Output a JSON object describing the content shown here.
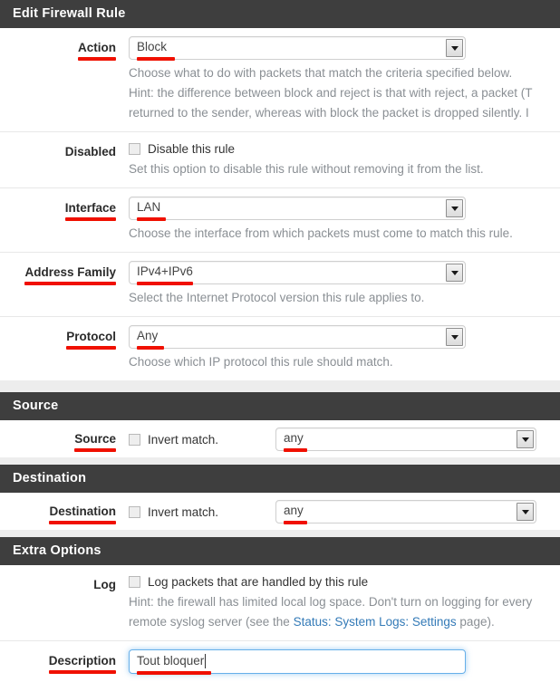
{
  "window": {
    "title": "Edit Firewall Rule"
  },
  "sections": {
    "source_title": "Source",
    "destination_title": "Destination",
    "extra_options_title": "Extra Options"
  },
  "colors": {
    "header_bg": "#3e3e3e",
    "header_text": "#ffffff",
    "annotation_red": "#f01000",
    "link_blue": "#337ab7",
    "focus_blue": "#66afe9",
    "hint_gray": "#8a8f94"
  },
  "fields": {
    "action": {
      "label": "Action",
      "value": "Block",
      "hint_line1": "Choose what to do with packets that match the criteria specified below.",
      "hint_line2": "Hint: the difference between block and reject is that with reject, a packet (T",
      "hint_line3": "returned to the sender, whereas with block the packet is dropped silently. I"
    },
    "disabled": {
      "label": "Disabled",
      "checkbox_label": "Disable this rule",
      "checked": false,
      "hint": "Set this option to disable this rule without removing it from the list."
    },
    "interface": {
      "label": "Interface",
      "value": "LAN",
      "hint": "Choose the interface from which packets must come to match this rule."
    },
    "address_family": {
      "label": "Address Family",
      "value": "IPv4+IPv6",
      "hint": "Select the Internet Protocol version this rule applies to."
    },
    "protocol": {
      "label": "Protocol",
      "value": "Any",
      "hint": "Choose which IP protocol this rule should match."
    },
    "source": {
      "label": "Source",
      "invert_label": "Invert match.",
      "invert_checked": false,
      "value": "any"
    },
    "destination": {
      "label": "Destination",
      "invert_label": "Invert match.",
      "invert_checked": false,
      "value": "any"
    },
    "log": {
      "label": "Log",
      "checkbox_label": "Log packets that are handled by this rule",
      "checked": false,
      "hint_line1": "Hint: the firewall has limited local log space. Don't turn on logging for every",
      "hint_line2_pre": "remote syslog server (see the ",
      "hint_link": "Status: System Logs: Settings",
      "hint_line2_post": " page)."
    },
    "description": {
      "label": "Description",
      "value": "Tout bloquer",
      "placeholder": ""
    }
  },
  "icons": {
    "dropdown": "chevron-down-icon",
    "checkbox": "checkbox-icon"
  }
}
